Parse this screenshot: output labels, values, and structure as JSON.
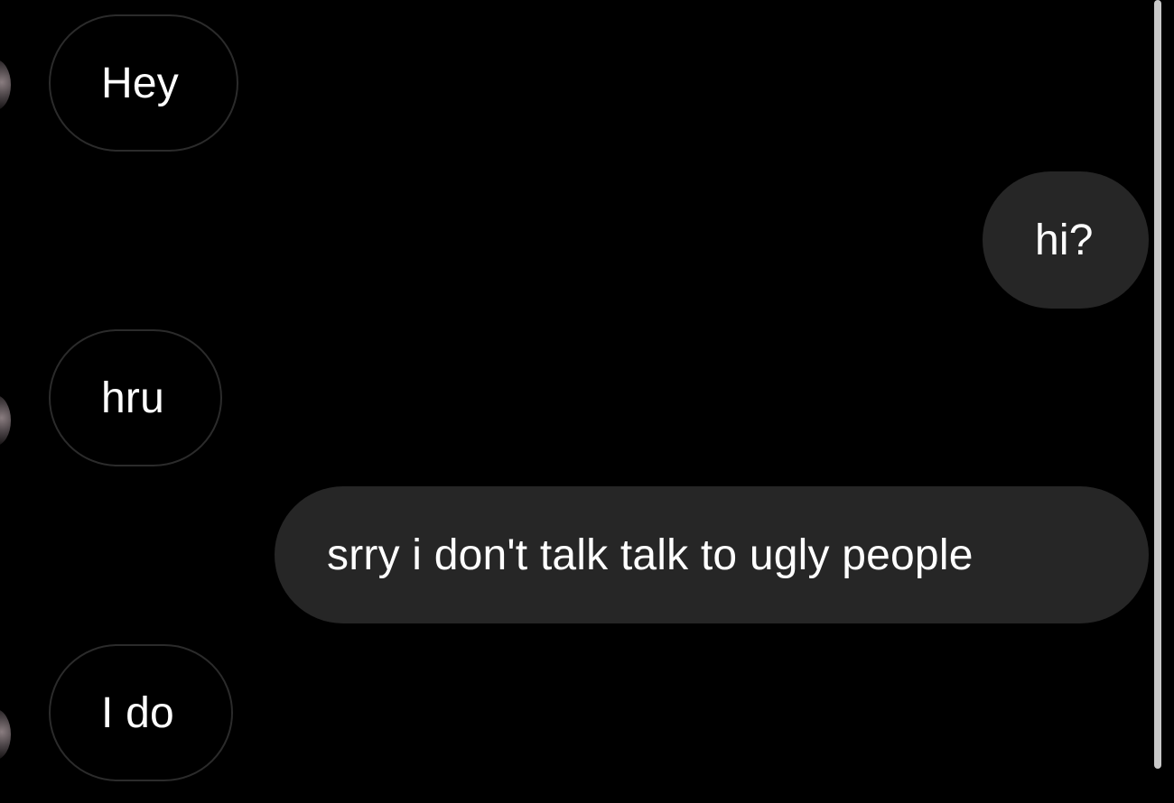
{
  "conversation": {
    "messages": [
      {
        "direction": "incoming",
        "text": "Hey"
      },
      {
        "direction": "outgoing",
        "text": "hi?"
      },
      {
        "direction": "incoming",
        "text": "hru"
      },
      {
        "direction": "outgoing",
        "text": "srry i don't talk talk to ugly people"
      },
      {
        "direction": "incoming",
        "text": "I do"
      }
    ]
  },
  "colors": {
    "background": "#000000",
    "incoming_border": "#2b2b2b",
    "outgoing_bubble": "#262626",
    "text": "#ffffff",
    "scrollbar": "#c9c9c9"
  }
}
